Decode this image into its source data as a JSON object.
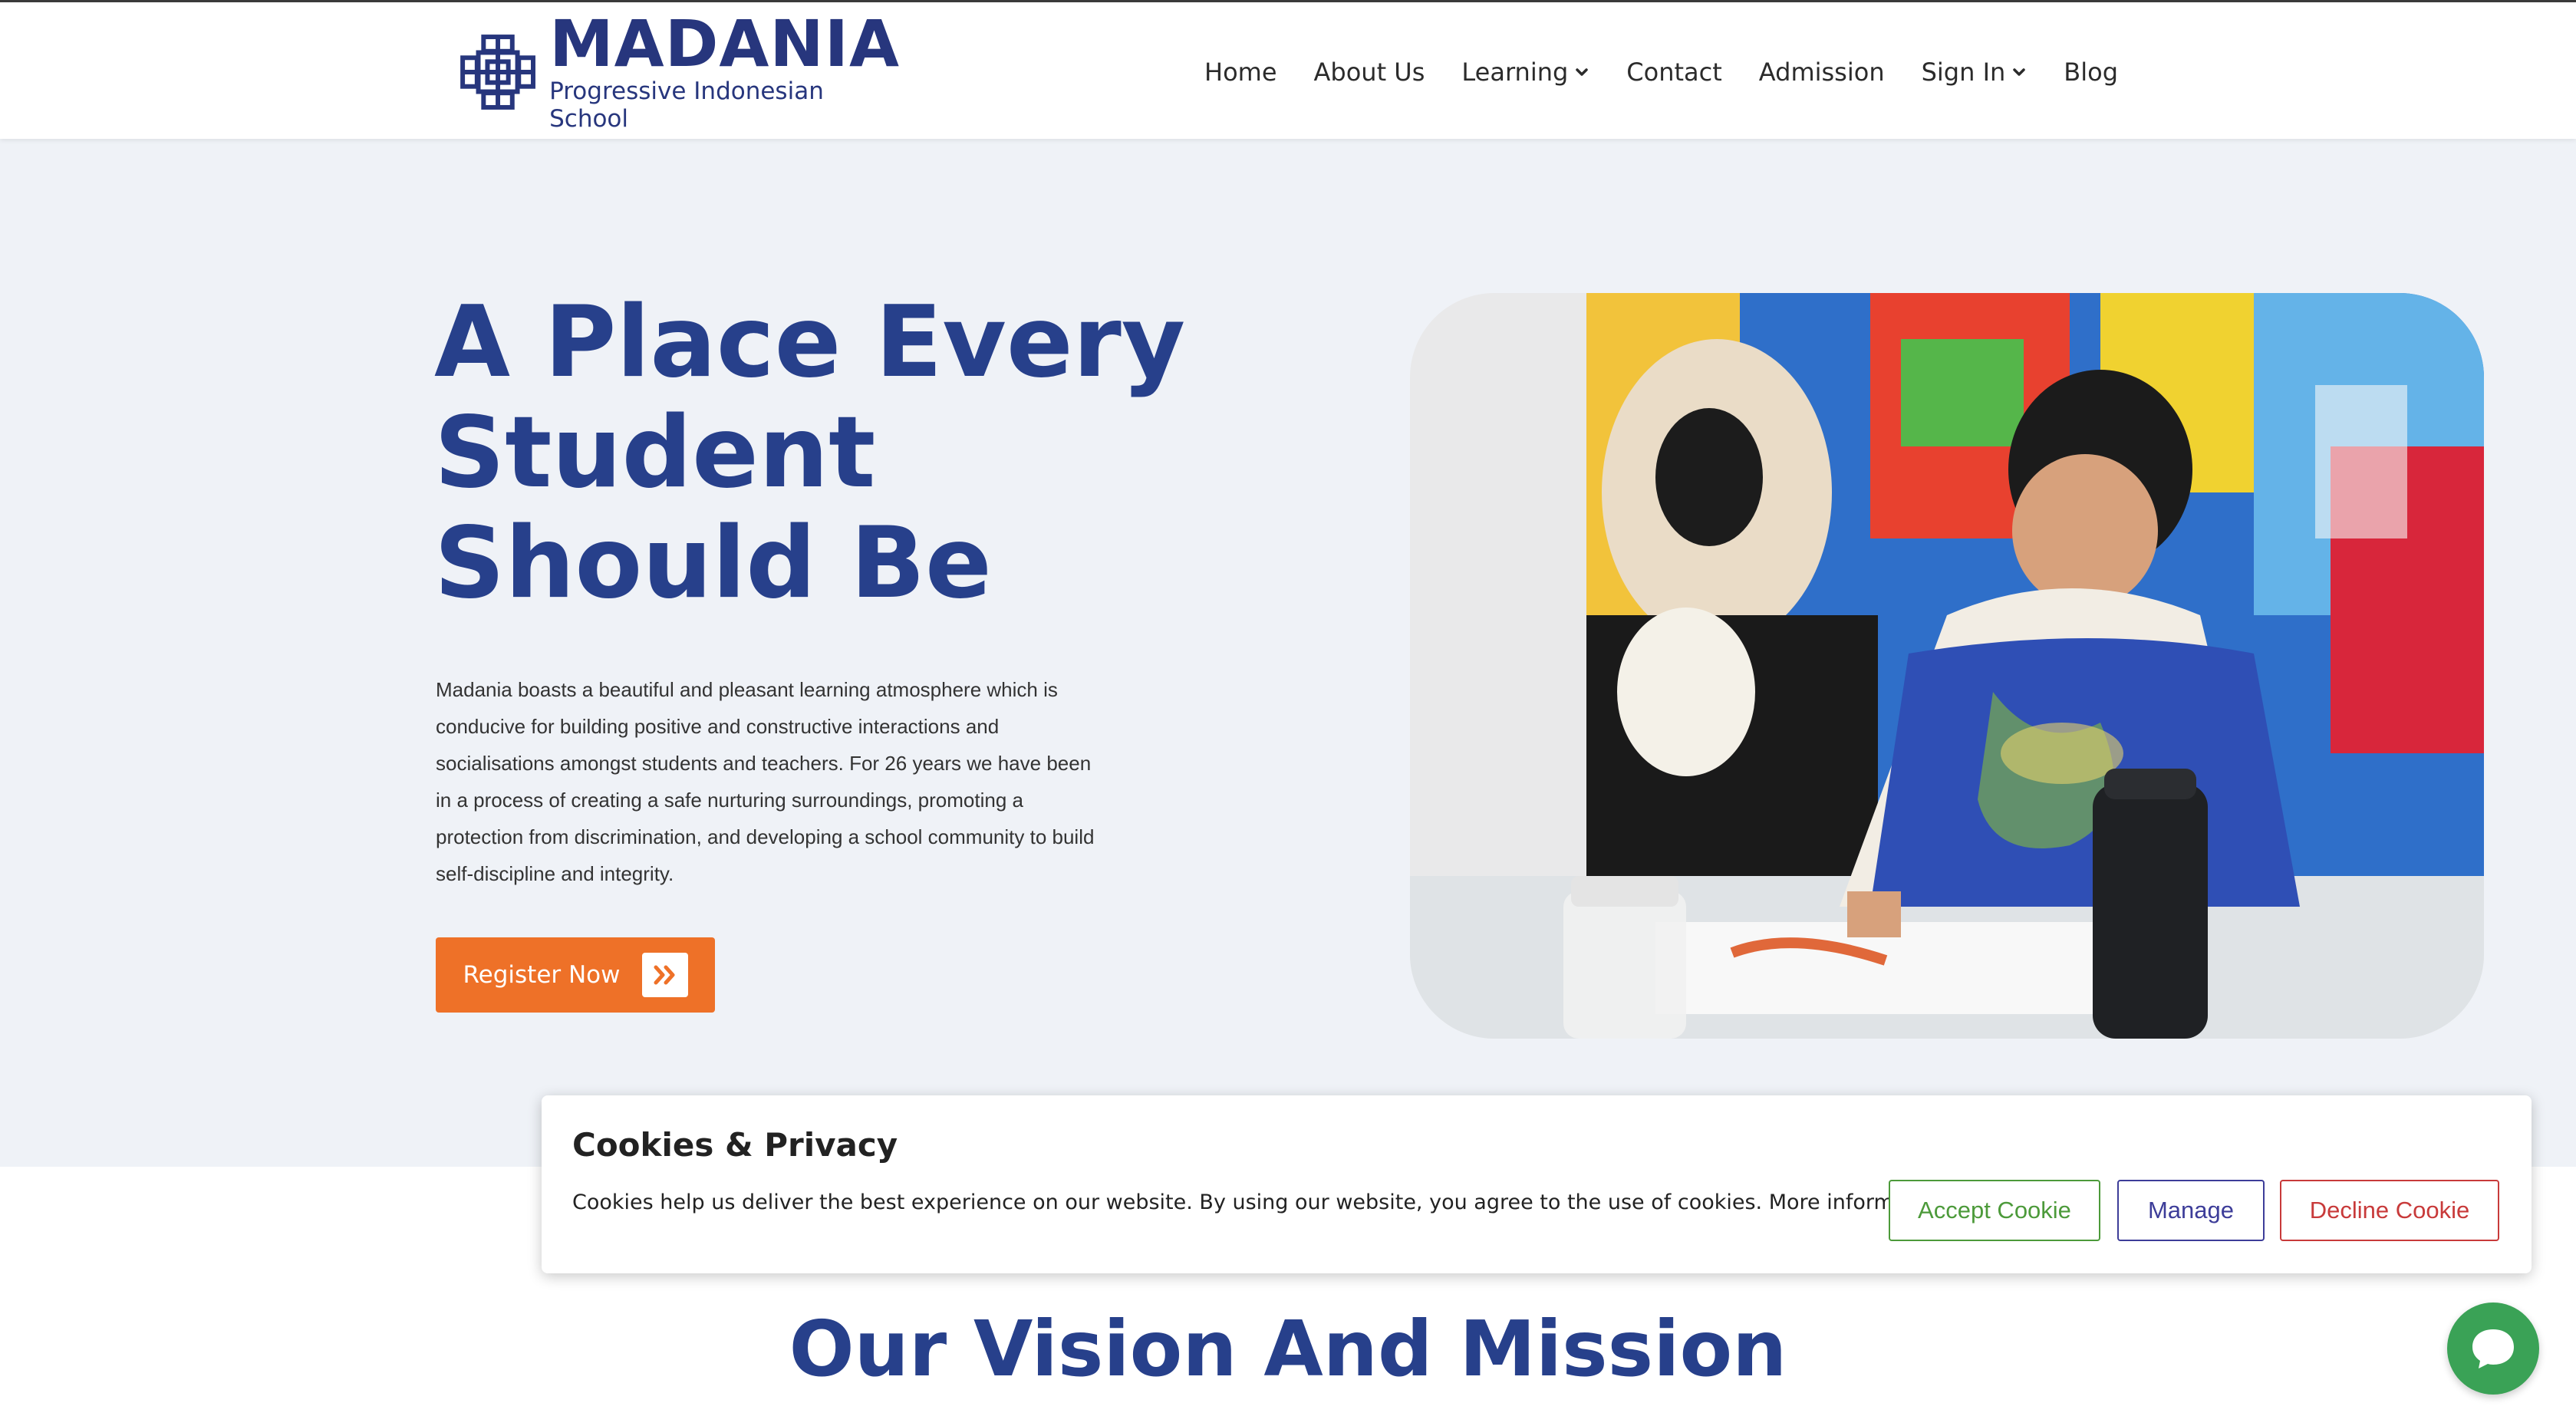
{
  "header": {
    "logo_name": "MADANIA",
    "logo_tagline": "Progressive Indonesian School",
    "nav": [
      {
        "label": "Home"
      },
      {
        "label": "About Us"
      },
      {
        "label": "Learning"
      },
      {
        "label": "Contact"
      },
      {
        "label": "Admission"
      },
      {
        "label": "Sign In"
      },
      {
        "label": "Blog"
      }
    ]
  },
  "hero": {
    "title": "A Place Every Student Should Be",
    "description": "Madania boasts a beautiful and pleasant learning atmosphere which is conducive for building positive and constructive interactions and socialisations amongst students and teachers. For 26 years we have been in a process of creating a safe nurturing surroundings, promoting a protection from discrimination, and developing a school community to build self-discipline and integrity.",
    "register_label": "Register Now"
  },
  "cookie": {
    "title": "Cookies & Privacy",
    "text": "Cookies help us deliver the best experience on our website. By using our website, you agree to the use of cookies.",
    "more_link": "More information",
    "accept_label": "Accept Cookie",
    "manage_label": "Manage",
    "decline_label": "Decline Cookie"
  },
  "section": {
    "vision_title": "Our Vision And Mission"
  },
  "colors": {
    "brand_blue": "#27408b",
    "accent_orange": "#ee7128",
    "hero_bg": "#eff2f7",
    "chat_green": "#3aa256"
  }
}
